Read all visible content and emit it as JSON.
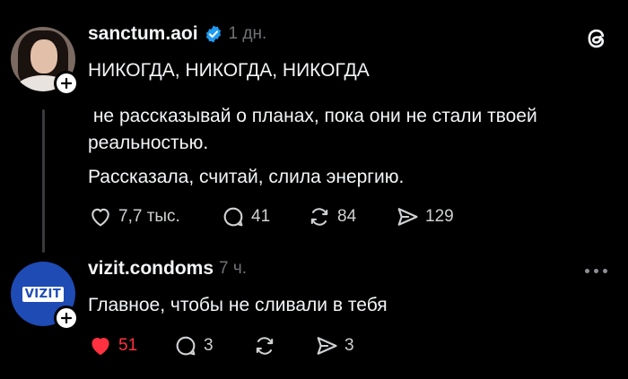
{
  "post": {
    "username": "sanctum.aoi",
    "time": "1 дн.",
    "verified_icon": "verified-badge-icon",
    "lines": [
      "НИКОГДА, НИКОГДА, НИКОГДА",
      " не рассказывай о планах, пока они не стали твоей",
      "реальностью.",
      "Рассказала, считай, слила энергию."
    ],
    "likes": "7,7 тыс.",
    "comments": "41",
    "reposts": "84",
    "shares": "129"
  },
  "reply": {
    "username": "vizit.condoms",
    "time": "7 ч.",
    "avatar_text": "VIZIT",
    "text": "Главное, чтобы не сливали в тебя",
    "likes": "51",
    "comments": "3",
    "shares": "3"
  },
  "colors": {
    "background": "#000000",
    "text": "#f3f5f7",
    "muted": "#6f7275",
    "like_active": "#ff3040",
    "verified": "#1d9bf0",
    "vizit_brand": "#1f4bb5"
  }
}
